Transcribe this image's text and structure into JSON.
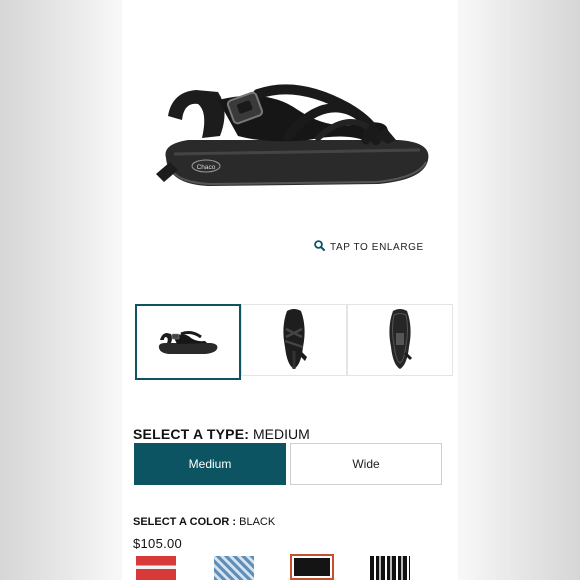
{
  "enlarge": {
    "label": "TAP TO ENLARGE",
    "icon": "search-icon"
  },
  "thumbnails": [
    {
      "name": "side-view",
      "selected": true
    },
    {
      "name": "top-view",
      "selected": false
    },
    {
      "name": "sole-view",
      "selected": false
    }
  ],
  "type_selector": {
    "heading": "SELECT A TYPE:",
    "value": "MEDIUM",
    "options": [
      {
        "label": "Medium",
        "selected": true
      },
      {
        "label": "Wide",
        "selected": false
      }
    ]
  },
  "color_selector": {
    "heading": "SELECT A COLOR :",
    "value": "BLACK",
    "price": "$105.00",
    "swatches": [
      {
        "name": "red-white-pattern",
        "selected": false
      },
      {
        "name": "blue-pattern",
        "selected": false
      },
      {
        "name": "black",
        "selected": true
      },
      {
        "name": "black-white-pattern",
        "selected": false
      }
    ]
  },
  "colors": {
    "accent": "#0c5462",
    "selected_swatch_border": "#c9502a"
  },
  "brand_logo_text": "Chaco"
}
